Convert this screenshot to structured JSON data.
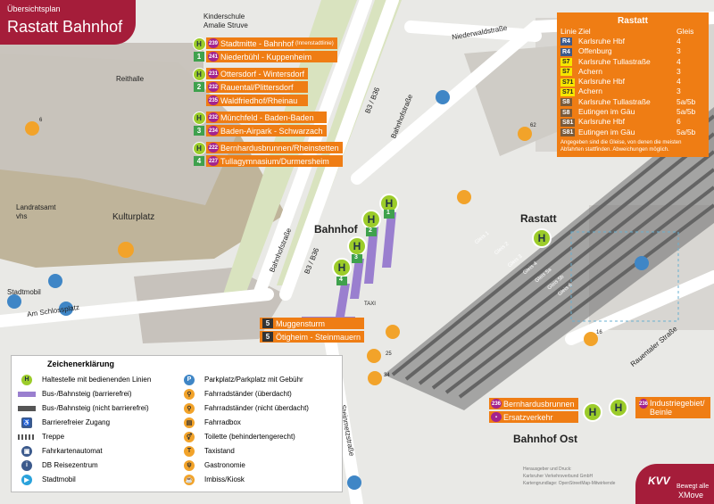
{
  "title": {
    "small": "Übersichtsplan",
    "big": "Rastatt Bahnhof"
  },
  "routes": [
    {
      "stop": "1",
      "lines": [
        {
          "num": "239",
          "text": "Stadtmitte - Bahnhof",
          "note": "(Innenstadtlinie)"
        },
        {
          "num": "241",
          "text": "Niederbühl - Kuppenheim",
          "note": ""
        }
      ]
    },
    {
      "stop": "2",
      "lines": [
        {
          "num": "231",
          "text": "Ottersdorf - Wintersdorf",
          "note": ""
        },
        {
          "num": "232",
          "text": "Rauental/Plittersdorf",
          "note": ""
        },
        {
          "num": "235",
          "text": "Waldfriedhof/Rheinau",
          "note": ""
        }
      ]
    },
    {
      "stop": "3",
      "lines": [
        {
          "num": "232",
          "text": "Münchfeld - Baden-Baden",
          "note": ""
        },
        {
          "num": "234",
          "text": "Baden-Airpark - Schwarzach",
          "note": ""
        }
      ]
    },
    {
      "stop": "4",
      "lines": [
        {
          "num": "222",
          "text": "Bernhardusbrunnen/Rheinstetten",
          "note": ""
        },
        {
          "num": "227",
          "text": "Tullagymnasium/Durmersheim",
          "note": ""
        }
      ]
    }
  ],
  "rastatt_table": {
    "title": "Rastatt",
    "headers": {
      "linie": "Linie",
      "ziel": "Ziel",
      "gleis": "Gleis"
    },
    "rows": [
      {
        "line": "R4",
        "ziel": "Karlsruhe Hbf",
        "gleis": "4",
        "bg": "#3c5a8c",
        "fg": "#ffffff"
      },
      {
        "line": "R4",
        "ziel": "Offenburg",
        "gleis": "3",
        "bg": "#3c5a8c",
        "fg": "#ffffff"
      },
      {
        "line": "S7",
        "ziel": "Karlsruhe Tullastraße",
        "gleis": "4",
        "bg": "#f7e600",
        "fg": "#222222"
      },
      {
        "line": "S7",
        "ziel": "Achern",
        "gleis": "3",
        "bg": "#f7e600",
        "fg": "#222222"
      },
      {
        "line": "S71",
        "ziel": "Karlsruhe Hbf",
        "gleis": "4",
        "bg": "#f7e600",
        "fg": "#222222"
      },
      {
        "line": "S71",
        "ziel": "Achern",
        "gleis": "3",
        "bg": "#f7e600",
        "fg": "#222222"
      },
      {
        "line": "S8",
        "ziel": "Karlsruhe Tullastraße",
        "gleis": "5a/5b",
        "bg": "#7a5a3a",
        "fg": "#ffffff"
      },
      {
        "line": "S8",
        "ziel": "Eutingen im Gäu",
        "gleis": "5a/5b",
        "bg": "#7a5a3a",
        "fg": "#ffffff"
      },
      {
        "line": "S81",
        "ziel": "Karlsruhe Hbf",
        "gleis": "6",
        "bg": "#7a5a3a",
        "fg": "#ffffff"
      },
      {
        "line": "S81",
        "ziel": "Eutingen im Gäu",
        "gleis": "5a/5b",
        "bg": "#7a5a3a",
        "fg": "#ffffff"
      }
    ],
    "note": "Angegeben sind die Gleise, von denen die meisten Abfahrten stattfinden. Abweichungen möglich."
  },
  "map_labels": {
    "kinderschule": "Kinderschule",
    "amalie": "Amalie Struve",
    "reithalle": "Reithalle",
    "landratsamt": "Landratsamt",
    "vhs": "vhs",
    "kulturplatz": "Kulturplatz",
    "stadtmobil": "Stadtmobil",
    "schlossplatz": "Am Schlossplatz",
    "bahnhofstrasse": "Bahnhofstraße",
    "b3a": "B3 / B36",
    "b3b": "B3 / B36",
    "bahnhofstrasse2": "Bahnhofstraße",
    "niederwald": "Niederwaldstraße",
    "bahnhof": "Bahnhof",
    "rastatt": "Rastatt",
    "steinmetz": "Steinmetzstraße",
    "rauentaler": "Rauentaler Straße",
    "bahnhof_ost": "Bahnhof Ost",
    "gleis1": "Gleis 1",
    "gleis2": "Gleis 2",
    "gleis3": "Gleis 3",
    "gleis4": "Gleis 4",
    "gleis5a": "Gleis 5a",
    "gleis5b": "Gleis 5b",
    "gleis6": "Gleis 6",
    "taxi": "TAXI",
    "bike6": "6",
    "bike62": "62",
    "bike16": "16",
    "bike25": "25",
    "bike34": "34"
  },
  "platforms": [
    "1",
    "2",
    "3",
    "4"
  ],
  "south_stop": {
    "num": "5",
    "lines": [
      {
        "text": "Muggensturm"
      },
      {
        "text": "Ötigheim - Steinmauern"
      }
    ]
  },
  "ost": {
    "left": [
      {
        "num": "236",
        "text": "Bernhardusbrunnen"
      },
      {
        "num": "",
        "text": "Ersatzverkehr"
      }
    ],
    "right": {
      "num": "236",
      "text": "Industriegebiet/ Beinle"
    }
  },
  "legend": {
    "title": "Zeichenerklärung",
    "left": [
      "Haltestelle mit bedienenden Linien",
      "Bus-/Bahnsteig (barrierefrei)",
      "Bus-/Bahnsteig (nicht barrierefrei)",
      "Barrierefreier Zugang",
      "Treppe",
      "Fahrkartenautomat",
      "DB Reisezentrum",
      "Stadtmobil"
    ],
    "right": [
      "Parkplatz/Parkplatz mit Gebühr",
      "Fahrradständer (überdacht)",
      "Fahrradständer (nicht überdacht)",
      "Fahrradbox",
      "Toilette (behindertengerecht)",
      "Taxistand",
      "Gastronomie",
      "Imbiss/Kiosk"
    ]
  },
  "footer": {
    "credit1": "Herausgeber und Druck:",
    "credit2": "Karlsruher Verkehrsverbund GmbH",
    "credit3": "Kartengrundlage: OpenStreetMap-Mitwirkende",
    "kvv": "KVV",
    "xmove": "Bewegt alle",
    "xmove2": "XMove"
  },
  "colors": {
    "orange": "#ef7d14",
    "kvv_red": "#a51d3a",
    "stop_green": "#9ccc2a",
    "platform_purple": "#9a7fcf",
    "bus_purple": "#a3238e"
  }
}
